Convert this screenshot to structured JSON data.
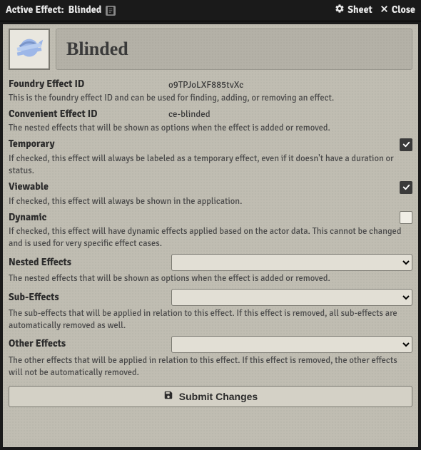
{
  "titlebar": {
    "title_prefix": "Active Effect:",
    "title_name": "Blinded",
    "sheet_label": "Sheet",
    "close_label": "Close"
  },
  "header": {
    "name": "Blinded"
  },
  "fields": {
    "foundry_id": {
      "label": "Foundry Effect ID",
      "value": "o9TPJoLXF885tvXc",
      "hint": "This is the foundry effect ID and can be used for finding, adding, or removing an effect."
    },
    "convenient_id": {
      "label": "Convenient Effect ID",
      "value": "ce-blinded",
      "hint": "The nested effects that will be shown as options when the effect is added or removed."
    },
    "temporary": {
      "label": "Temporary",
      "checked": true,
      "hint": "If checked, this effect will always be labeled as a temporary effect, even if it doesn't have a duration or status."
    },
    "viewable": {
      "label": "Viewable",
      "checked": true,
      "hint": "If checked, this effect will always be shown in the application."
    },
    "dynamic": {
      "label": "Dynamic",
      "checked": false,
      "hint": "If checked, this effect will have dynamic effects applied based on the actor data. This cannot be changed and is used for very specific effect cases."
    },
    "nested": {
      "label": "Nested Effects",
      "hint": "The nested effects that will be shown as options when the effect is added or removed."
    },
    "sub": {
      "label": "Sub-Effects",
      "hint": "The sub-effects that will be applied in relation to this effect. If this effect is removed, all sub-effects are automatically removed as well."
    },
    "other": {
      "label": "Other Effects",
      "hint": "The other effects that will be applied in relation to this effect. If this effect is removed, the other effects will not be automatically removed."
    }
  },
  "submit_label": "Submit Changes"
}
